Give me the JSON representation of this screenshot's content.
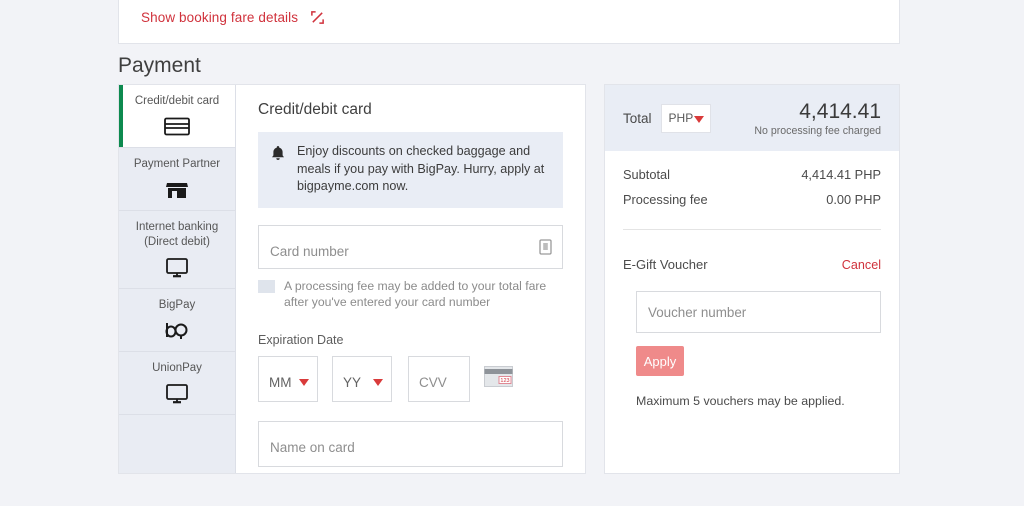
{
  "fare": {
    "link_label": "Show booking fare details",
    "expand_icon": "expand-icon"
  },
  "section": {
    "title": "Payment"
  },
  "methods": [
    {
      "label": "Credit/debit card",
      "icon": "credit-card-icon",
      "active": true
    },
    {
      "label": "Payment Partner",
      "icon": "storefront-icon",
      "active": false
    },
    {
      "label": "Internet banking (Direct debit)",
      "icon": "monitor-icon",
      "active": false
    },
    {
      "label": "BigPay",
      "icon": "bigpay-logo-icon",
      "active": false
    },
    {
      "label": "UnionPay",
      "icon": "monitor-icon",
      "active": false
    }
  ],
  "form": {
    "title": "Credit/debit card",
    "notice": {
      "icon": "bell-icon",
      "text": "Enjoy discounts on checked baggage and meals if you pay with BigPay. Hurry, apply at bigpayme.com now."
    },
    "card_number": {
      "value": "",
      "placeholder": "Card number",
      "icon": "card-secure-icon"
    },
    "processing_hint": "A processing fee may be added to your total fare after you've entered your card number",
    "expiration_label": "Expiration Date",
    "month": {
      "value": "MM",
      "placeholder": "MM"
    },
    "year": {
      "value": "YY",
      "placeholder": "YY"
    },
    "cvv": {
      "value": "",
      "placeholder": "CVV"
    },
    "cvv_icon": "card-back-cvv-icon",
    "name_on_card": {
      "value": "",
      "placeholder": "Name on card"
    }
  },
  "summary": {
    "total_label": "Total",
    "currency": "PHP",
    "total_amount": "4,414.41",
    "total_note": "No processing fee charged",
    "rows": [
      {
        "label": "Subtotal",
        "value": "4,414.41 PHP"
      },
      {
        "label": "Processing fee",
        "value": "0.00 PHP"
      }
    ],
    "voucher": {
      "title": "E-Gift Voucher",
      "cancel_label": "Cancel",
      "input": {
        "value": "",
        "placeholder": "Voucher number"
      },
      "apply_label": "Apply",
      "max_note": "Maximum 5 vouchers may be applied."
    }
  },
  "colors": {
    "accent_red": "#d0323c",
    "active_green": "#0d8a4f",
    "apply_pink": "#ef8a8a",
    "panel_bg": "#e9edf5"
  }
}
